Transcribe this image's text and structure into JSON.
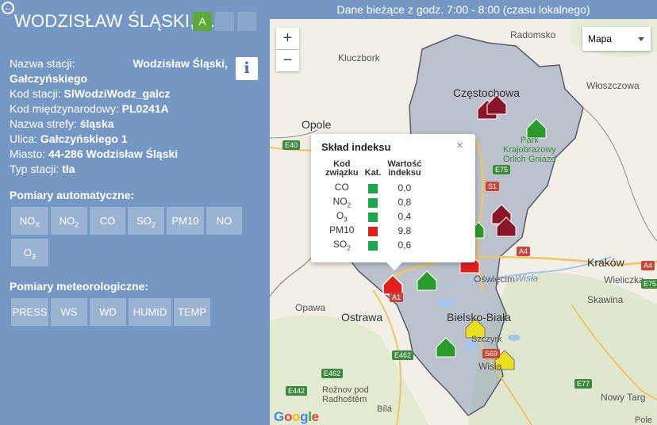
{
  "header": {
    "title": "Dane bieżące z godz. 7:00 - 8:00 (czasu lokalnego)",
    "station_title": "WODZISŁAW ŚLĄSKI, ...",
    "badges": [
      "A",
      "",
      ""
    ]
  },
  "info": {
    "name_label": "Nazwa stacji:",
    "name_value_1": "Wodzisław Śląski,",
    "name_value_2": "Gałczyńskiego",
    "code_label": "Kod stacji:",
    "code_value": "SlWodziWodz_galcz",
    "intl_label": "Kod międzynarodowy:",
    "intl_value": "PL0241A",
    "zone_label": "Nazwa strefy:",
    "zone_value": "śląska",
    "street_label": "Ulica:",
    "street_value": "Gałczyńskiego 1",
    "city_label": "Miasto:",
    "city_value": "44-286 Wodzisław Śląski",
    "type_label": "Typ stacji:",
    "type_value": "tła"
  },
  "sections": {
    "auto_title": "Pomiary automatyczne:",
    "meteo_title": "Pomiary meteorologiczne:"
  },
  "auto_buttons": {
    "nox": [
      "NO",
      "X"
    ],
    "no2": [
      "NO",
      "2"
    ],
    "co": "CO",
    "so2": [
      "SO",
      "2"
    ],
    "pm10": "PM10",
    "no": "NO",
    "o3": [
      "O",
      "3"
    ]
  },
  "meteo_buttons": [
    "PRESS",
    "WS",
    "WD",
    "HUMID",
    "TEMP"
  ],
  "map": {
    "type_label": "Mapa",
    "zoom_in": "+",
    "zoom_out": "−",
    "google": "Google",
    "labels": {
      "radomsko": "Radomsko",
      "kluczbork": "Kluczbork",
      "wloszczowa": "Włoszczowa",
      "czestochowa": "Częstochowa",
      "opole": "Opole",
      "park": [
        "Park",
        "Krajobrazowy",
        "Orlich Gniazd"
      ],
      "oswiecim": "Oświęcim",
      "krakow": "Kraków",
      "wieliczka": "Wieliczka",
      "skawina": "Skawina",
      "opawa": "Opawa",
      "ostrawa": "Ostrawa",
      "bielsko": "Bielsko-Biała",
      "szczyrk": "Szczyrk",
      "wisla": "Wisła",
      "wisla_river": "Wisła",
      "roznov": [
        "Rožnov pod",
        "Radhoštěm"
      ],
      "nowy_targ": "Nowy Targ",
      "bila": "Bílá",
      "pole": "Pole"
    },
    "roads": [
      "E40",
      "E75",
      "S1",
      "A4",
      "A1",
      "E462",
      "E462",
      "E442",
      "S69",
      "E77",
      "E75",
      "A4"
    ]
  },
  "popup": {
    "title": "Skład indeksu",
    "close": "×",
    "col_code": [
      "Kod",
      "związku"
    ],
    "col_cat": "Kat.",
    "col_value": [
      "Wartość",
      "indeksu"
    ],
    "rows": [
      {
        "code": "CO",
        "sub": "",
        "color": "#1aa74e",
        "value": "0,0"
      },
      {
        "code": "NO",
        "sub": "2",
        "color": "#1aa74e",
        "value": "0,8"
      },
      {
        "code": "O",
        "sub": "3",
        "color": "#1aa74e",
        "value": "0,4"
      },
      {
        "code": "PM10",
        "sub": "",
        "color": "#e01c1c",
        "value": "9,8"
      },
      {
        "code": "SO",
        "sub": "2",
        "color": "#1aa74e",
        "value": "0,6"
      }
    ]
  },
  "colors": {
    "panel": "#7597c3",
    "very_good": "#5aaa34",
    "good_marker": "#2a9a2a",
    "moderate_marker": "#e8e020",
    "bad_marker": "#e02020",
    "very_bad_marker": "#8a1428"
  }
}
